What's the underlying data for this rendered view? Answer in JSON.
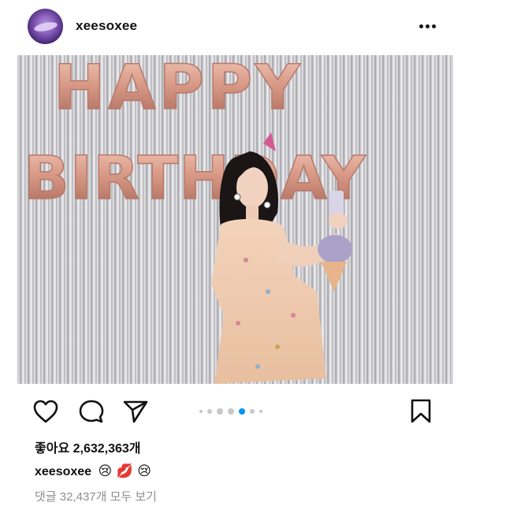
{
  "post": {
    "username": "xeesoxee",
    "likes_text": "좋아요 2,632,363개",
    "caption_user": "xeesoxee",
    "caption_emojis": "😢 💋 😢",
    "comments_link": "댓글 32,437개 모두 보기",
    "photo_text": "HAPPY BIRTHDAY",
    "carousel": {
      "total": 7,
      "active_index": 4
    }
  },
  "icons": {
    "like": "heart-icon",
    "comment": "comment-bubble-icon",
    "share": "paper-plane-icon",
    "save": "bookmark-icon",
    "more": "more-options-icon"
  },
  "colors": {
    "active_dot": "#0095f6",
    "inactive_dot": "#c7c7c7",
    "balloon": "#d9a08f"
  }
}
